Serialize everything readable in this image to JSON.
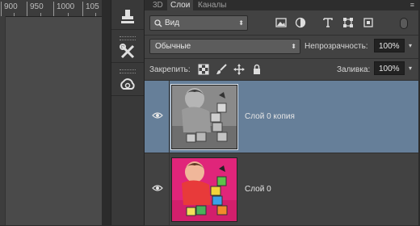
{
  "ruler": {
    "ticks": [
      "900",
      "950",
      "1000",
      "105"
    ]
  },
  "tabs": [
    {
      "label": "3D",
      "active": false
    },
    {
      "label": "Слои",
      "active": true
    },
    {
      "label": "Каналы",
      "active": false
    }
  ],
  "filter": {
    "selected": "Вид"
  },
  "blend": {
    "mode": "Обычные",
    "opacity_label": "Непрозрачность:",
    "opacity_value": "100%"
  },
  "lock": {
    "label": "Закрепить:",
    "fill_label": "Заливка:",
    "fill_value": "100%"
  },
  "layers": [
    {
      "name": "Слой 0 копия",
      "selected": true,
      "visible": true,
      "style": "grayscale"
    },
    {
      "name": "Слой 0",
      "selected": false,
      "visible": true,
      "style": "color"
    }
  ],
  "colors": {
    "selection": "#667f99",
    "panel": "#424242",
    "color_bg": "#e0257a"
  },
  "icons": [
    "stamp-icon",
    "tools-icon",
    "creative-cloud-icon",
    "picture-icon",
    "text-icon",
    "transform-icon",
    "adjustment-icon",
    "checkerboard-lock-icon",
    "brush-lock-icon",
    "move-lock-icon",
    "padlock-icon",
    "eye-icon"
  ]
}
